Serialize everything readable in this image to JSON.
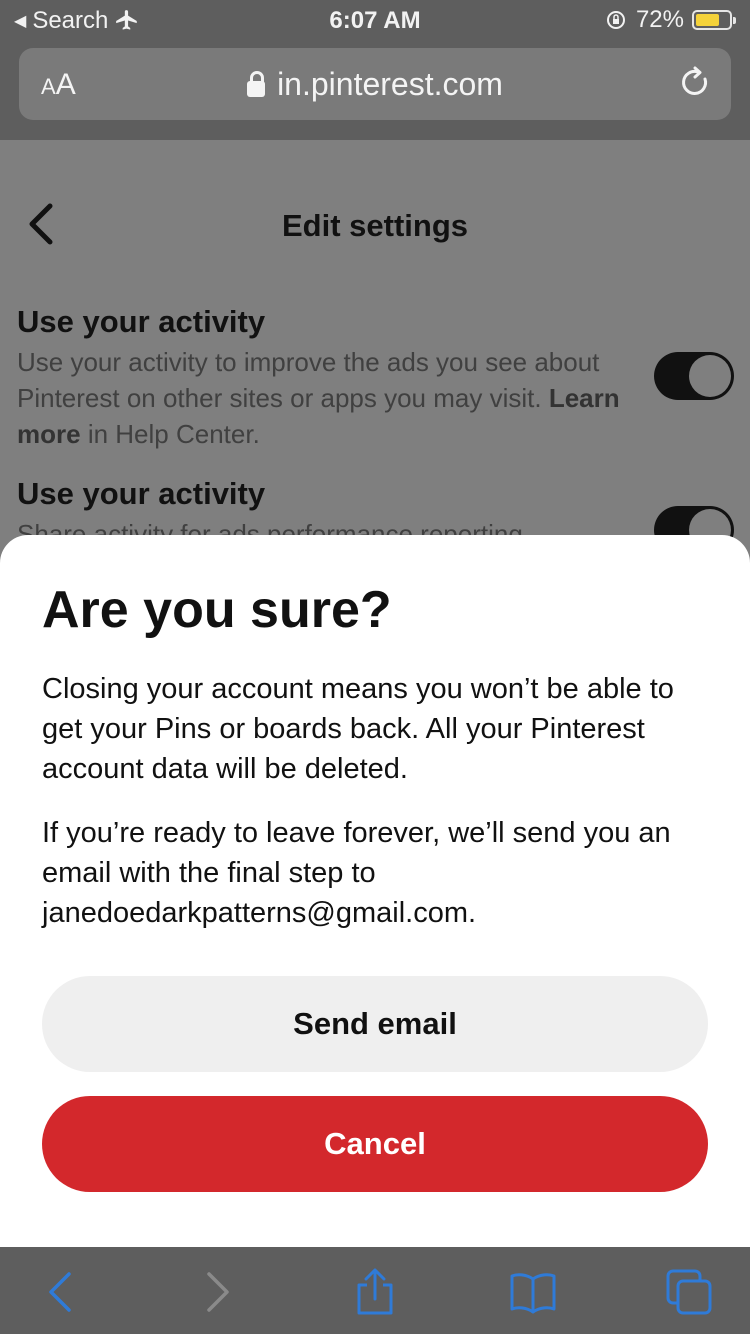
{
  "status_bar": {
    "back_app": "Search",
    "time": "6:07 AM",
    "battery": "72%",
    "battery_level": 0.72,
    "icons": [
      "back-triangle-icon",
      "airplane-icon",
      "rotation-lock-icon",
      "battery-icon"
    ]
  },
  "url_bar": {
    "text_size_label": "AA",
    "url": "in.pinterest.com"
  },
  "page": {
    "title": "Edit settings",
    "settings": [
      {
        "title": "Use your activity",
        "desc_before": "Use your activity to improve the ads you see about Pinterest on other sites or apps you may visit.",
        "desc_link": "Learn more",
        "desc_after": "in Help Center.",
        "enabled": true
      },
      {
        "title": "Use your activity",
        "desc": "Share activity for ads performance reporting",
        "enabled": true
      }
    ]
  },
  "dialog": {
    "title": "Are you sure?",
    "paragraph1": "Closing your account means you won’t be able to get your Pins or boards back. All your Pinterest account data will be deleted.",
    "paragraph2": "If you’re ready to leave forever, we’ll send you an email with the final step to janedoedarkpatterns@gmail.com.",
    "send_label": "Send email",
    "cancel_label": "Cancel"
  },
  "colors": {
    "accent_red": "#d3282c",
    "safari_blue": "#2f7bd8"
  }
}
